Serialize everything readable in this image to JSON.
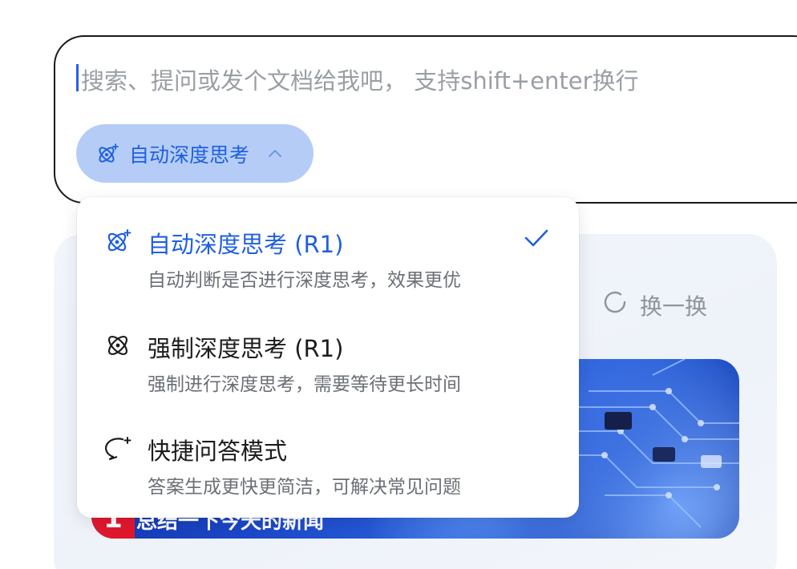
{
  "input": {
    "placeholder": "搜索、提问或发个文档给我吧， 支持shift+enter换行"
  },
  "mode_chip": {
    "label": "自动深度思考",
    "icon": "atom-sparkle-icon",
    "chevron": "chevron-up-icon"
  },
  "dropdown": {
    "options": [
      {
        "title": "自动深度思考 (R1)",
        "desc": "自动判断是否进行深度思考，效果更优",
        "icon": "atom-sparkle-icon",
        "selected": true
      },
      {
        "title": "强制深度思考 (R1)",
        "desc": "强制进行深度思考，需要等待更长时间",
        "icon": "atom-icon",
        "selected": false
      },
      {
        "title": "快捷问答模式",
        "desc": "答案生成更快更简洁，可解决常见问题",
        "icon": "chat-bubble-sparkle-icon",
        "selected": false
      }
    ]
  },
  "background": {
    "refresh_label": "换一换",
    "news": {
      "rank": "1",
      "title": "总结一下今天的新闻"
    }
  },
  "colors": {
    "accent": "#1f5fe0",
    "chip_bg": "#b5cdf6",
    "news_rank": "#e0182e"
  }
}
